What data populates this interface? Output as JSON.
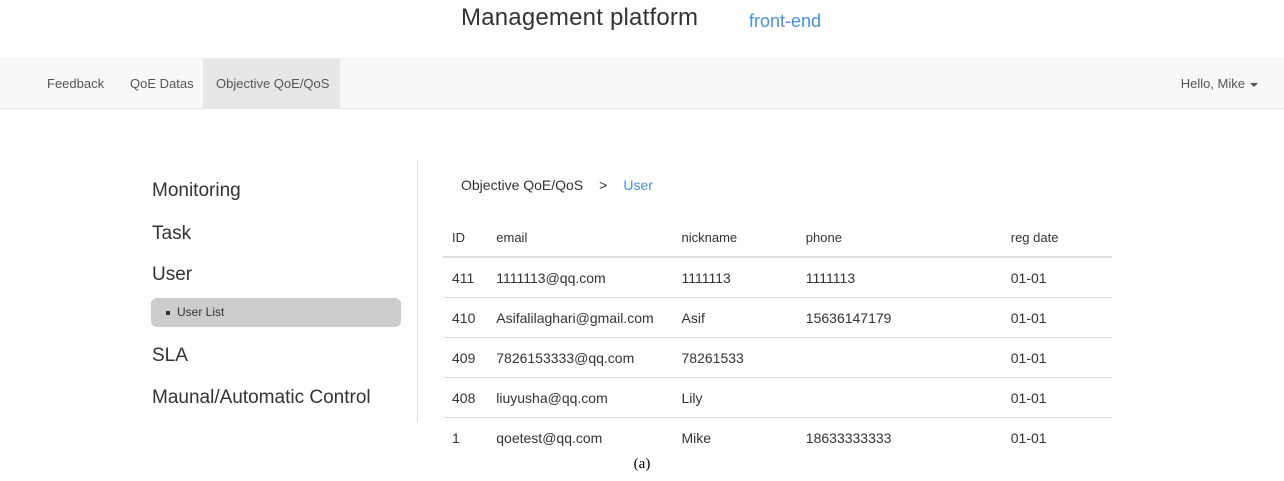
{
  "header": {
    "title": "Management platform",
    "subtitle": "front-end"
  },
  "navbar": {
    "items": [
      {
        "label": "Feedback",
        "active": false
      },
      {
        "label": "QoE Datas",
        "active": false
      },
      {
        "label": "Objective QoE/QoS",
        "active": true
      }
    ],
    "user_menu_label": "Hello, Mike"
  },
  "sidebar": {
    "items": [
      {
        "label": "Monitoring"
      },
      {
        "label": "Task"
      },
      {
        "label": "User"
      },
      {
        "label": "SLA"
      },
      {
        "label": "Maunal/Automatic Control"
      }
    ],
    "user_sub_items": [
      {
        "label": "User List",
        "selected": true
      }
    ]
  },
  "breadcrumb": {
    "parent": "Objective QoE/QoS",
    "separator": ">",
    "current": "User"
  },
  "table": {
    "headers": [
      "ID",
      "email",
      "nickname",
      "phone",
      "reg date"
    ],
    "rows": [
      [
        "411",
        "1111113@qq.com",
        "1111113",
        "1111113",
        "01-01"
      ],
      [
        "410",
        "Asifalilaghari@gmail.com",
        "Asif",
        "15636147179",
        "01-01"
      ],
      [
        "409",
        "7826153333@qq.com",
        "78261533",
        "",
        "01-01"
      ],
      [
        "408",
        "liuyusha@qq.com",
        "Lily",
        "",
        "01-01"
      ],
      [
        "1",
        "qoetest@qq.com",
        "Mike",
        "18633333333",
        "01-01"
      ]
    ]
  },
  "caption": "(a)",
  "colors": {
    "accent": "#4a90d9",
    "navbar_bg": "#f8f8f8",
    "active_tab_bg": "#e7e7e7",
    "selected_sub_item_bg": "#cccccc"
  }
}
